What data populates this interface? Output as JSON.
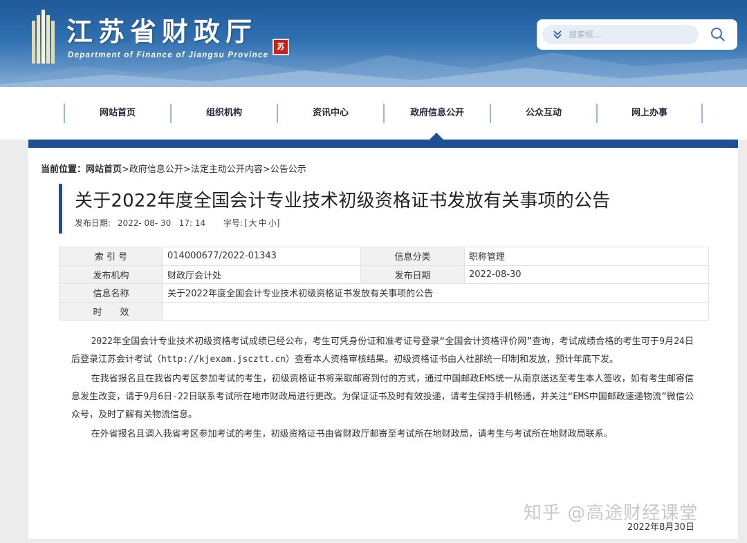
{
  "header": {
    "site_title": "江苏省财政厅",
    "site_subtitle": "Department of Finance of Jiangsu Province",
    "seal_text": "苏",
    "search_placeholder": "搜索框..."
  },
  "nav": {
    "items": [
      "网站首页",
      "组织机构",
      "资讯中心",
      "政府信息公开",
      "公众互动",
      "网上办事"
    ],
    "active_index": 3
  },
  "breadcrumb": {
    "prefix": "当前位置：",
    "home": "网站首页",
    "path": ">政府信息公开>法定主动公开内容>公告公示"
  },
  "article": {
    "title": "关于2022年度全国会计专业技术初级资格证书发放有关事项的公告",
    "publish_label": "发布日期:",
    "publish_date": "2022- 08- 30   17: 14",
    "font_label": "字号:",
    "font_open": "[",
    "font_large": "大",
    "font_medium": "中",
    "font_small": "小",
    "font_close": "]"
  },
  "info": {
    "index_label": "索 引 号",
    "index_value": "014000677/2022-01343",
    "category_label": "信息分类",
    "category_value": "职称管理",
    "org_label": "发布机构",
    "org_value": "财政厅会计处",
    "date_label": "发布日期",
    "date_value": "2022-08-30",
    "name_label": "信息名称",
    "name_value": "关于2022年度全国会计专业技术初级资格证书发放有关事项的公告",
    "validity_label": "时　　效",
    "validity_value": ""
  },
  "body": {
    "paragraphs": [
      "2022年全国会计专业技术初级资格考试成绩已经公布，考生可凭身份证和准考证号登录“全国会计资格评价网”查询，考试成绩合格的考生可于9月24日后登录江苏会计考试（http://kjexam.jscztt.cn）查看本人资格审核结果。初级资格证书由人社部统一印制和发放，预计年底下发。",
      "在我省报名且在我省内考区参加考试的考生，初级资格证书将采取邮寄到付的方式，通过中国邮政EMS统一从南京送达至考生本人签收，如有考生邮寄信息发生改变，请于9月6日-22日联系考试所在地市财政局进行更改。为保证证书及时有效投递，请考生保持手机畅通，并关注“EMS中国邮政速递物流”微信公众号，及时了解有关物流信息。",
      "在外省报名且调入我省考区参加考试的考生，初级资格证书由省财政厅邮寄至考试所在地财政局，请考生与考试所在地财政局联系。"
    ],
    "sign_date": "2022年8月30日"
  },
  "watermark": "知乎 @高途财经课堂",
  "colors": {
    "primary_blue": "#1d4f91",
    "banner_blue": "#2f6fb0",
    "seal_red": "#c8201c"
  }
}
